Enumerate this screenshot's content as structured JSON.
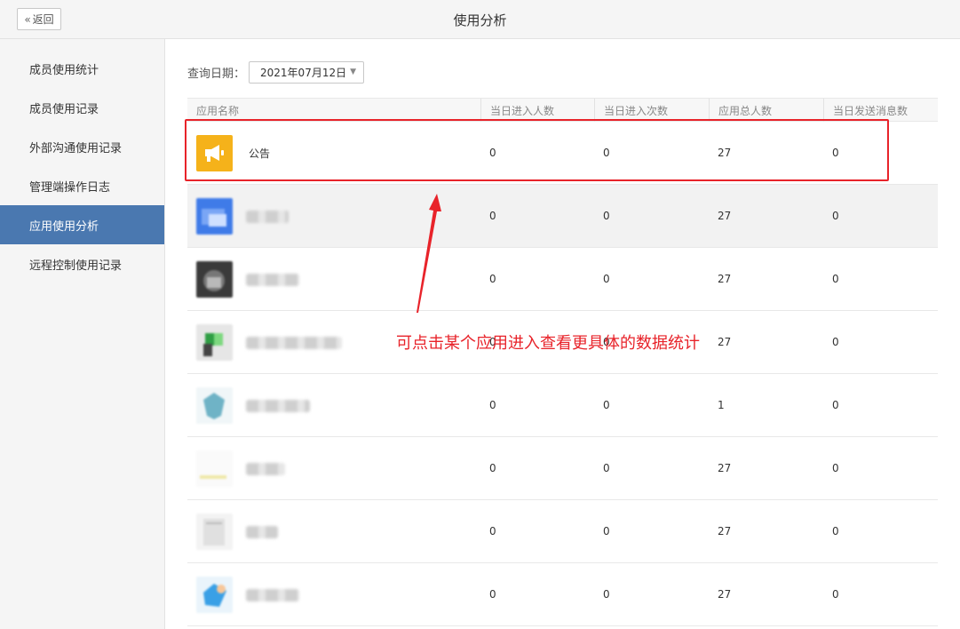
{
  "header": {
    "back_label": "返回",
    "title": "使用分析"
  },
  "sidebar": {
    "items": [
      {
        "label": "成员使用统计",
        "active": false
      },
      {
        "label": "成员使用记录",
        "active": false
      },
      {
        "label": "外部沟通使用记录",
        "active": false
      },
      {
        "label": "管理端操作日志",
        "active": false
      },
      {
        "label": "应用使用分析",
        "active": true
      },
      {
        "label": "远程控制使用记录",
        "active": false
      }
    ]
  },
  "filter": {
    "date_label": "查询日期：",
    "date_value": "2021年07月12日"
  },
  "table": {
    "columns": [
      "应用名称",
      "当日进入人数",
      "当日进入次数",
      "应用总人数",
      "当日发送消息数"
    ],
    "rows": [
      {
        "name": "公告",
        "entries_users": "0",
        "entries_count": "0",
        "total_users": "27",
        "messages": "0"
      },
      {
        "name": "",
        "entries_users": "0",
        "entries_count": "0",
        "total_users": "27",
        "messages": "0"
      },
      {
        "name": "",
        "entries_users": "0",
        "entries_count": "0",
        "total_users": "27",
        "messages": "0"
      },
      {
        "name": "",
        "entries_users": "0",
        "entries_count": "0",
        "total_users": "27",
        "messages": "0"
      },
      {
        "name": "",
        "entries_users": "0",
        "entries_count": "0",
        "total_users": "1",
        "messages": "0"
      },
      {
        "name": "",
        "entries_users": "0",
        "entries_count": "0",
        "total_users": "27",
        "messages": "0"
      },
      {
        "name": "",
        "entries_users": "0",
        "entries_count": "0",
        "total_users": "27",
        "messages": "0"
      },
      {
        "name": "",
        "entries_users": "0",
        "entries_count": "0",
        "total_users": "27",
        "messages": "0"
      }
    ]
  },
  "annotation": {
    "text": "可点击某个应用进入查看更具体的数据统计",
    "color": "#e8232a"
  },
  "colors": {
    "accent": "#4a78b0",
    "announcement_icon": "#f5b21a",
    "annotation": "#e8232a"
  }
}
